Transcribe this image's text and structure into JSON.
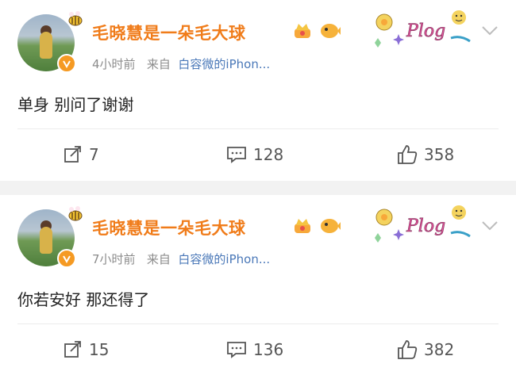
{
  "posts": [
    {
      "user": "毛晓慧是一朵毛大球",
      "time": "4小时前",
      "from_label": "来自",
      "source": "白容微的iPhon...",
      "plog_text": "Plog",
      "content": "单身 别问了谢谢",
      "reposts": "7",
      "comments": "128",
      "likes": "358"
    },
    {
      "user": "毛晓慧是一朵毛大球",
      "time": "7小时前",
      "from_label": "来自",
      "source": "白容微的iPhon...",
      "plog_text": "Plog",
      "content": "你若安好 那还得了",
      "reposts": "15",
      "comments": "136",
      "likes": "382"
    }
  ],
  "colors": {
    "name": "#f07c1a",
    "source": "#4a78b8",
    "meta": "#8c8c8c",
    "bg": "#f2f2f2"
  },
  "icons": [
    "avatar",
    "verified-badge-icon",
    "crown-icon",
    "pufferfish-icon",
    "plog-sticker",
    "chevron-down-icon",
    "repost-icon",
    "comment-icon",
    "like-icon"
  ]
}
